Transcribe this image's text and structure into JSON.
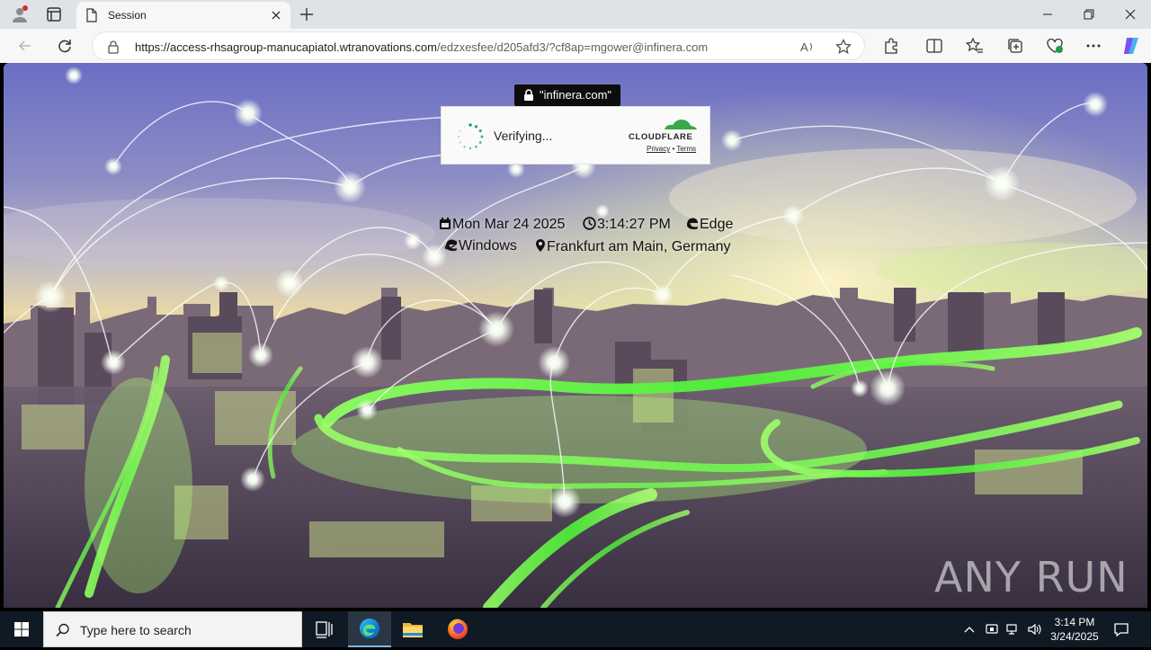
{
  "browser": {
    "tab_title": "Session",
    "url_host": "https://access-rhsagroup-manucapiatol.wtranovations.com",
    "url_path": "/edzxesfee/d205afd3/?cf8ap=mgower@infinera.com"
  },
  "page": {
    "domain_badge": "\"infinera.com\"",
    "captcha": {
      "status": "Verifying...",
      "brand": "CLOUDFLARE",
      "privacy": "Privacy",
      "sep": "•",
      "terms": "Terms"
    },
    "info": {
      "date": "Mon Mar 24 2025",
      "time": "3:14:27 PM",
      "browser": "Edge",
      "os": "Windows",
      "location": "Frankfurt am Main, Germany"
    },
    "watermark": "ANY RUN"
  },
  "taskbar": {
    "search_placeholder": "Type here to search",
    "time": "3:14 PM",
    "date": "3/24/2025"
  },
  "colors": {
    "accent_edge": "#0a7dd6",
    "cloudflare": "#f38020",
    "city_glow": "#5cff3a"
  },
  "icons": [
    "profile-icon",
    "tab-actions-icon",
    "document-icon",
    "close-icon",
    "plus-icon",
    "minimize-icon",
    "restore-icon",
    "window-close-icon",
    "back-icon",
    "refresh-icon",
    "lock-icon",
    "read-aloud-icon",
    "star-icon",
    "extensions-icon",
    "split-screen-icon",
    "favorites-icon",
    "collections-icon",
    "health-icon",
    "more-icon",
    "copilot-icon",
    "calendar-icon",
    "clock-icon",
    "edge-icon",
    "ie-icon",
    "map-pin-icon",
    "windows-logo-icon",
    "search-icon",
    "task-view-icon",
    "file-explorer-icon",
    "firefox-icon",
    "chevron-up-icon",
    "network-icon",
    "volume-icon",
    "notification-icon"
  ]
}
